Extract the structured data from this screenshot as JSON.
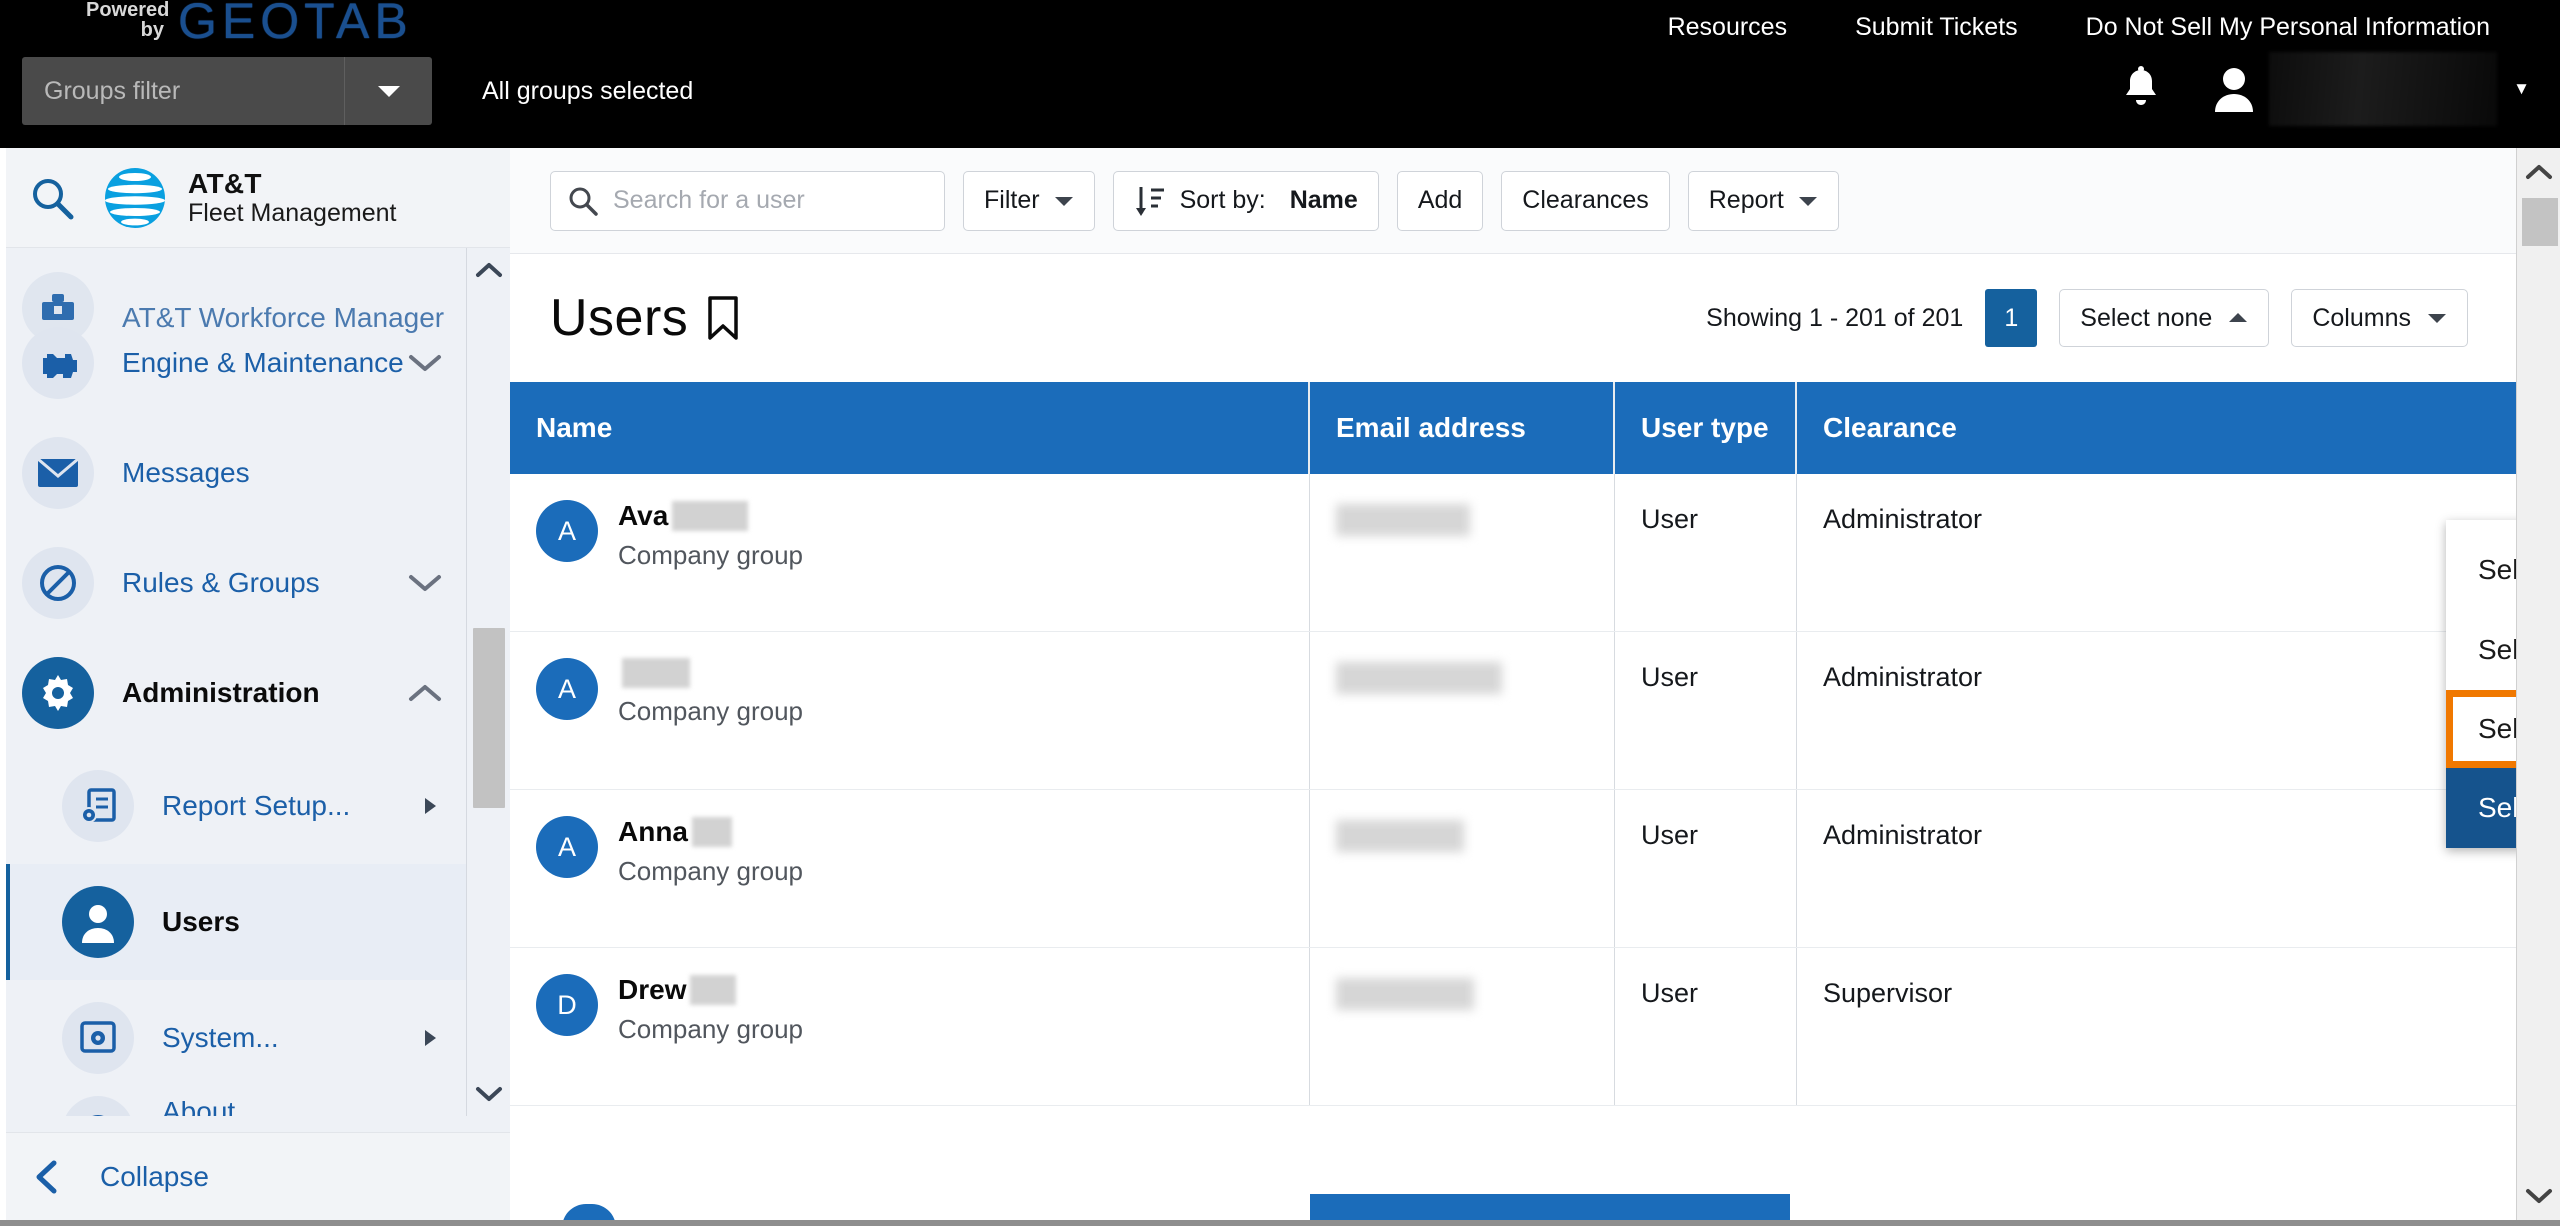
{
  "topbar": {
    "powered_line1": "Powered",
    "powered_line2": "by",
    "brand": "GEOTAB",
    "links": [
      "Resources",
      "Submit Tickets",
      "Do Not Sell My Personal Information"
    ],
    "groups_filter_placeholder": "Groups filter",
    "groups_status": "All groups selected",
    "notification_icon": "bell-icon",
    "account_icon": "person-icon",
    "account_name": "",
    "account_caret": "▼"
  },
  "sidebar": {
    "search_icon": "search-icon",
    "brand_line1": "AT&T",
    "brand_line2": "Fleet Management",
    "items": [
      {
        "label": "AT&T Workforce Manager",
        "icon": "workforce-icon",
        "state": "clipped",
        "expander": ""
      },
      {
        "label": "Engine & Maintenance",
        "icon": "engine-icon",
        "state": "normal",
        "expander": "chevron-down"
      },
      {
        "label": "Messages",
        "icon": "envelope-icon",
        "state": "normal",
        "expander": ""
      },
      {
        "label": "Rules & Groups",
        "icon": "rules-icon",
        "state": "normal",
        "expander": "chevron-down"
      },
      {
        "label": "Administration",
        "icon": "gear-icon",
        "state": "active",
        "expander": "chevron-up"
      }
    ],
    "subitems": [
      {
        "label": "Report Setup...",
        "icon": "report-setup-icon",
        "state": "normal",
        "expander": "arrow-right"
      },
      {
        "label": "Users",
        "icon": "users-icon",
        "state": "selected",
        "expander": ""
      },
      {
        "label": "System...",
        "icon": "system-icon",
        "state": "normal",
        "expander": "arrow-right"
      },
      {
        "label": "About",
        "icon": "info-icon",
        "state": "clipped",
        "expander": ""
      }
    ],
    "collapse_label": "Collapse",
    "collapse_icon": "chevron-left-icon"
  },
  "toolbar": {
    "search_placeholder": "Search for a user",
    "search_icon": "search-icon",
    "filter_label": "Filter",
    "filter_caret": "▼",
    "sort_icon": "sort-icon",
    "sort_label": "Sort by:",
    "sort_value": "Name",
    "add_label": "Add",
    "clearances_label": "Clearances",
    "report_label": "Report",
    "report_caret": "▼"
  },
  "page": {
    "title": "Users",
    "bookmark_icon": "bookmark-icon",
    "showing": "Showing 1 - 201 of 201",
    "page_number": "1",
    "select_button_label": "Select none",
    "select_button_caret": "▲",
    "columns_label": "Columns",
    "columns_caret": "▼"
  },
  "dropdown": {
    "items": [
      {
        "label": "Select visible",
        "state": "normal"
      },
      {
        "label": "Select individual",
        "state": "normal"
      },
      {
        "label": "Select all",
        "state": "highlight"
      },
      {
        "label": "Select none",
        "state": "selected"
      }
    ],
    "highlight_color": "#f07800",
    "selected_color": "#15538d"
  },
  "table": {
    "columns": [
      "Name",
      "Email address",
      "User type",
      "Clearance"
    ],
    "rows": [
      {
        "initial": "A",
        "name": "Ava",
        "name_redacted_width": 76,
        "group": "Company group",
        "email": "",
        "email_redacted_width": 134,
        "user_type": "User",
        "clearance": "Administrator"
      },
      {
        "initial": "A",
        "name": "",
        "name_redacted_width": 68,
        "group": "Company group",
        "email": "",
        "email_redacted_width": 166,
        "user_type": "User",
        "clearance": "Administrator"
      },
      {
        "initial": "A",
        "name": "Anna",
        "name_redacted_width": 40,
        "group": "Company group",
        "email": "",
        "email_redacted_width": 128,
        "user_type": "User",
        "clearance": "Administrator"
      },
      {
        "initial": "D",
        "name": "Drew",
        "name_redacted_width": 46,
        "group": "Company group",
        "email": "",
        "email_redacted_width": 138,
        "user_type": "User",
        "clearance": "Supervisor"
      }
    ]
  },
  "scrollbars": {
    "sidebar_up": "▲",
    "sidebar_down": "▼",
    "main_up": "▲",
    "main_down": "▼"
  },
  "colors": {
    "brand_blue": "#1b6cba",
    "dark_blue": "#15619e",
    "orange_highlight": "#f07800",
    "topbar_black": "#000000"
  }
}
